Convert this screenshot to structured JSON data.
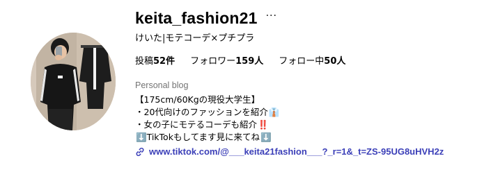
{
  "profile": {
    "username": "keita_fashion21",
    "more_label": "···",
    "full_name": "けいた|モテコーデ×プチプラ",
    "stats": {
      "posts_label": "投稿",
      "posts_value": "52件",
      "followers_label": "フォロワー",
      "followers_value": "159人",
      "following_label": "フォロー中",
      "following_value": "50人"
    },
    "category": "Personal blog",
    "bio": {
      "line1": "【175cm/60Kgの現役大学生】",
      "line2": "・20代向けのファッションを紹介",
      "line2_emoji": "👔",
      "line3": "・女の子にモテるコーデも紹介",
      "line3_emoji": "‼️",
      "line4_emoji_start": "⬇️",
      "line4": "TikTokもしてます見に来てね",
      "line4_emoji_end": "⬇️"
    },
    "link": "www.tiktok.com/@___keita21fashion___?_r=1&_t=ZS-95UG8uHVH2z"
  },
  "colors": {
    "link": "#3b3fb8",
    "category_text": "#737373",
    "text": "#000000"
  },
  "icons": {
    "more": "more-horizontal-icon",
    "link": "link-chain-icon",
    "avatar": "profile-photo"
  }
}
